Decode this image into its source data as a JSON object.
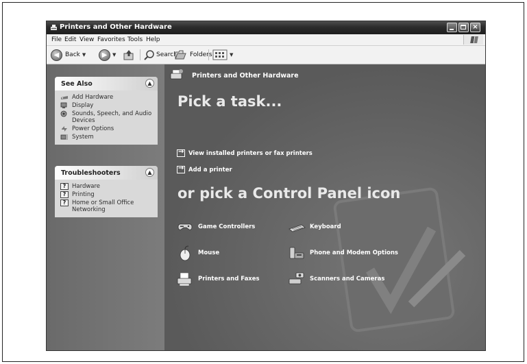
{
  "window": {
    "title": "Printers and Other Hardware",
    "controls": {
      "minimize": "minimize",
      "maximize": "maximize",
      "close": "×"
    }
  },
  "menubar": {
    "items": [
      "File",
      "Edit",
      "View",
      "Favorites",
      "Tools",
      "Help"
    ]
  },
  "toolbar": {
    "back": "Back",
    "search": "Search",
    "folders": "Folders"
  },
  "see_also": {
    "title": "See Also",
    "items": [
      {
        "label": "Add Hardware",
        "icon": "add-hardware-icon"
      },
      {
        "label": "Display",
        "icon": "display-icon"
      },
      {
        "label": "Sounds, Speech, and Audio Devices",
        "icon": "sounds-icon"
      },
      {
        "label": "Power Options",
        "icon": "power-icon"
      },
      {
        "label": "System",
        "icon": "system-icon"
      }
    ]
  },
  "troubleshooters": {
    "title": "Troubleshooters",
    "items": [
      {
        "label": "Hardware",
        "icon": "help-icon"
      },
      {
        "label": "Printing",
        "icon": "help-icon"
      },
      {
        "label": "Home or Small Office Networking",
        "icon": "help-icon"
      }
    ]
  },
  "main": {
    "breadcrumb": "Printers and Other Hardware",
    "task_heading": "Pick a task...",
    "tasks": [
      "View installed printers or fax printers",
      "Add a printer"
    ],
    "cp_heading": "or pick a Control Panel icon",
    "icons": [
      {
        "label": "Game Controllers",
        "icon": "game-controller-icon"
      },
      {
        "label": "Keyboard",
        "icon": "keyboard-icon"
      },
      {
        "label": "Mouse",
        "icon": "mouse-icon"
      },
      {
        "label": "Phone and Modem Options",
        "icon": "phone-icon"
      },
      {
        "label": "Printers and Faxes",
        "icon": "printer-icon"
      },
      {
        "label": "Scanners and Cameras",
        "icon": "scanner-icon"
      }
    ]
  }
}
